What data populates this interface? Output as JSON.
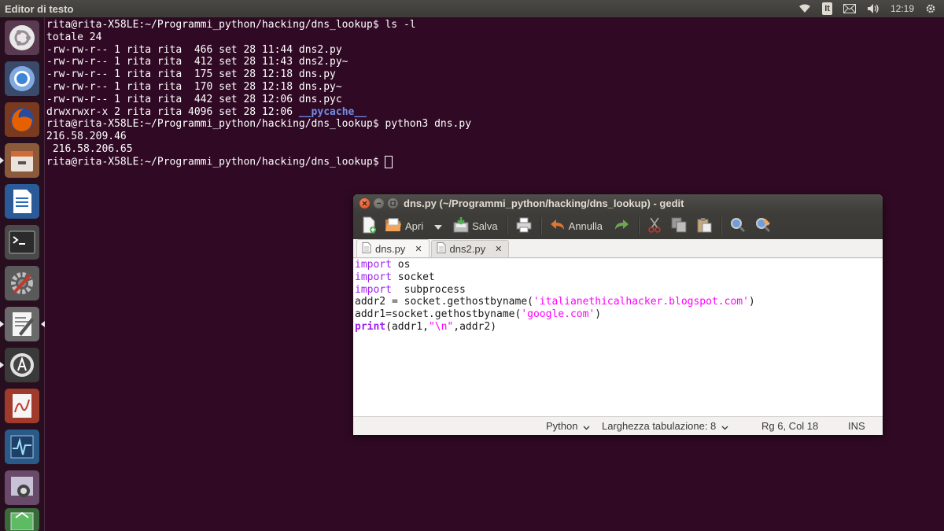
{
  "top_panel": {
    "app_title": "Editor di testo",
    "keyboard_layout": "It",
    "clock": "12:19",
    "icons": [
      "wifi-icon",
      "keyboard-layout-indicator",
      "mail-icon",
      "volume-icon",
      "settings-gear-icon"
    ]
  },
  "launcher": {
    "items": [
      {
        "name": "ubuntu-dash-icon",
        "color": "#dd4814"
      },
      {
        "name": "chromium-icon",
        "color": "#3c86d8"
      },
      {
        "name": "firefox-icon",
        "color": "#e66000"
      },
      {
        "name": "files-icon",
        "color": "#b87a52"
      },
      {
        "name": "libreoffice-writer-icon",
        "color": "#2a6db8"
      },
      {
        "name": "terminal-icon",
        "color": "#2b2b2b"
      },
      {
        "name": "system-settings-icon",
        "color": "#c0392b"
      },
      {
        "name": "text-editor-icon",
        "color": "#7a7a7a"
      },
      {
        "name": "software-updater-icon",
        "color": "#555555"
      },
      {
        "name": "document-viewer-icon",
        "color": "#c0392b"
      },
      {
        "name": "system-monitor-icon",
        "color": "#2a6db8"
      },
      {
        "name": "screenshot-icon",
        "color": "#8e44ad"
      },
      {
        "name": "app-icon",
        "color": "#27ae60"
      }
    ]
  },
  "terminal": {
    "lines": [
      "rita@rita-X58LE:~/Programmi_python/hacking/dns_lookup$ ls -l",
      "totale 24",
      "-rw-rw-r-- 1 rita rita  466 set 28 11:44 dns2.py",
      "-rw-rw-r-- 1 rita rita  412 set 28 11:43 dns2.py~",
      "-rw-rw-r-- 1 rita rita  175 set 28 12:18 dns.py",
      "-rw-rw-r-- 1 rita rita  170 set 28 12:18 dns.py~",
      "-rw-rw-r-- 1 rita rita  442 set 28 12:06 dns.pyc"
    ],
    "dir_line_prefix": "drwxrwxr-x 2 rita rita 4096 set 28 12:06 ",
    "dir_name": "__pycache__",
    "lines_after": [
      "rita@rita-X58LE:~/Programmi_python/hacking/dns_lookup$ python3 dns.py",
      "216.58.209.46",
      " 216.58.206.65"
    ],
    "prompt": "rita@rita-X58LE:~/Programmi_python/hacking/dns_lookup$ "
  },
  "gedit": {
    "title": "dns.py (~/Programmi_python/hacking/dns_lookup) - gedit",
    "toolbar": {
      "open_label": "Apri",
      "save_label": "Salva",
      "undo_label": "Annulla"
    },
    "tabs": [
      {
        "label": "dns.py",
        "active": true
      },
      {
        "label": "dns2.py",
        "active": false
      }
    ],
    "code": {
      "l1_kw": "import",
      "l1_rest": " os",
      "l2_kw": "import",
      "l2_rest": " socket",
      "l3_kw": "import",
      "l3_rest": "  subprocess",
      "l4_pre": "addr2 = socket.gethostbyname(",
      "l4_str": "'italianethicalhacker.blogspot.com'",
      "l4_post": ")",
      "l5_pre": "addr1=socket.gethostbyname(",
      "l5_str": "'google.com'",
      "l5_post": ")",
      "l6_kw": "print",
      "l6_a": "(addr1,",
      "l6_str": "\"\\n\"",
      "l6_b": ",addr2)"
    },
    "status": {
      "language": "Python",
      "tab_width": "Larghezza tabulazione: 8",
      "position": "Rg 6, Col 18",
      "mode": "INS"
    }
  }
}
